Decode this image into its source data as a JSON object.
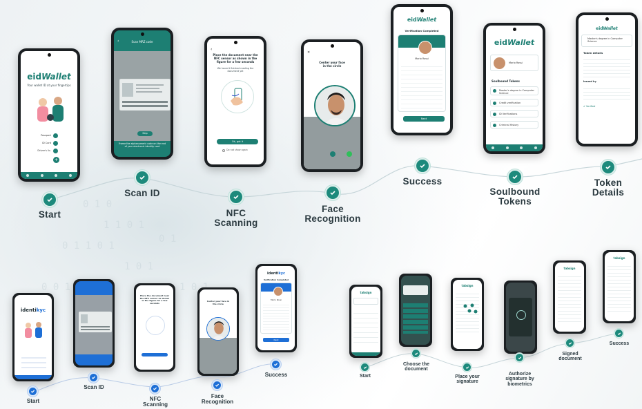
{
  "flow_top": {
    "steps": [
      {
        "label_line1": "Start",
        "label_line2": ""
      },
      {
        "label_line1": "Scan ID",
        "label_line2": ""
      },
      {
        "label_line1": "NFC",
        "label_line2": "Scanning"
      },
      {
        "label_line1": "Face",
        "label_line2": "Recognition"
      },
      {
        "label_line1": "Success",
        "label_line2": ""
      },
      {
        "label_line1": "Soulbound",
        "label_line2": "Tokens"
      },
      {
        "label_line1": "Token",
        "label_line2": "Details"
      }
    ],
    "screens": {
      "start": {
        "logo_a": "eid",
        "logo_b": "Wallet",
        "tagline": "Your wallet ID at your fingertips",
        "buttons": [
          "Passport",
          "ID Card",
          "Driver's lic."
        ]
      },
      "scan": {
        "title": "Scan MRZ code",
        "button": "Skip",
        "hint": "Frame the alphanumeric code on the end of your electronic identity card"
      },
      "nfc": {
        "instruction": "Place the document near the NFC sensor as shown in the figure for a few seconds",
        "sub": "We haven't finished reading the document yet",
        "button": "Ok, got it",
        "checkbox": "Do not show again"
      },
      "face": {
        "instruction": "Center your face in the circle"
      },
      "success": {
        "logo_a": "eid",
        "logo_b": "Wallet",
        "header": "Verification Completed",
        "name": "Mario Rossi",
        "button": "Next"
      },
      "soulbound": {
        "logo_a": "eid",
        "logo_b": "Wallet",
        "name": "Mario Rossi",
        "section": "Soulbound Tokens",
        "items": [
          "Master's degree in Computer Science",
          "Credit verification",
          "ID Verifications",
          "Criminal History"
        ]
      },
      "token": {
        "logo_a": "eid",
        "logo_b": "Wallet",
        "title": "Master's degree in Computer Science",
        "section": "Token details",
        "issued_by": "Issued by",
        "status": "Verified"
      }
    }
  },
  "flow_bottom_left": {
    "steps": [
      {
        "label_line1": "Start",
        "label_line2": ""
      },
      {
        "label_line1": "Scan ID",
        "label_line2": ""
      },
      {
        "label_line1": "NFC",
        "label_line2": "Scanning"
      },
      {
        "label_line1": "Face",
        "label_line2": "Recognition"
      },
      {
        "label_line1": "Success",
        "label_line2": ""
      }
    ],
    "screens": {
      "start": {
        "logo_a": "identi",
        "logo_b": "kyc"
      },
      "nfc": {
        "instruction": "Place the document near the NFC sensor as shown in the figure for a few seconds"
      },
      "face": {
        "instruction": "Center your face in the circle"
      },
      "success": {
        "logo_a": "identi",
        "logo_b": "kyc",
        "header": "Verification Completed",
        "name": "Mario Rossi",
        "button": "Next"
      }
    }
  },
  "flow_bottom_right": {
    "steps": [
      {
        "label_line1": "Start",
        "label_line2": ""
      },
      {
        "label_line1": "Choose the",
        "label_line2": "document"
      },
      {
        "label_line1": "Place your",
        "label_line2": "signature"
      },
      {
        "label_line1": "Authorize",
        "label_line2": "signature by",
        "label_line3": "biometrics"
      },
      {
        "label_line1": "Signed",
        "label_line2": "document"
      },
      {
        "label_line1": "Success",
        "label_line2": ""
      }
    ],
    "logo": "tabsign"
  },
  "colors": {
    "teal": "#1d7f73",
    "blue": "#1e6fd6",
    "text": "#2b3a40"
  }
}
